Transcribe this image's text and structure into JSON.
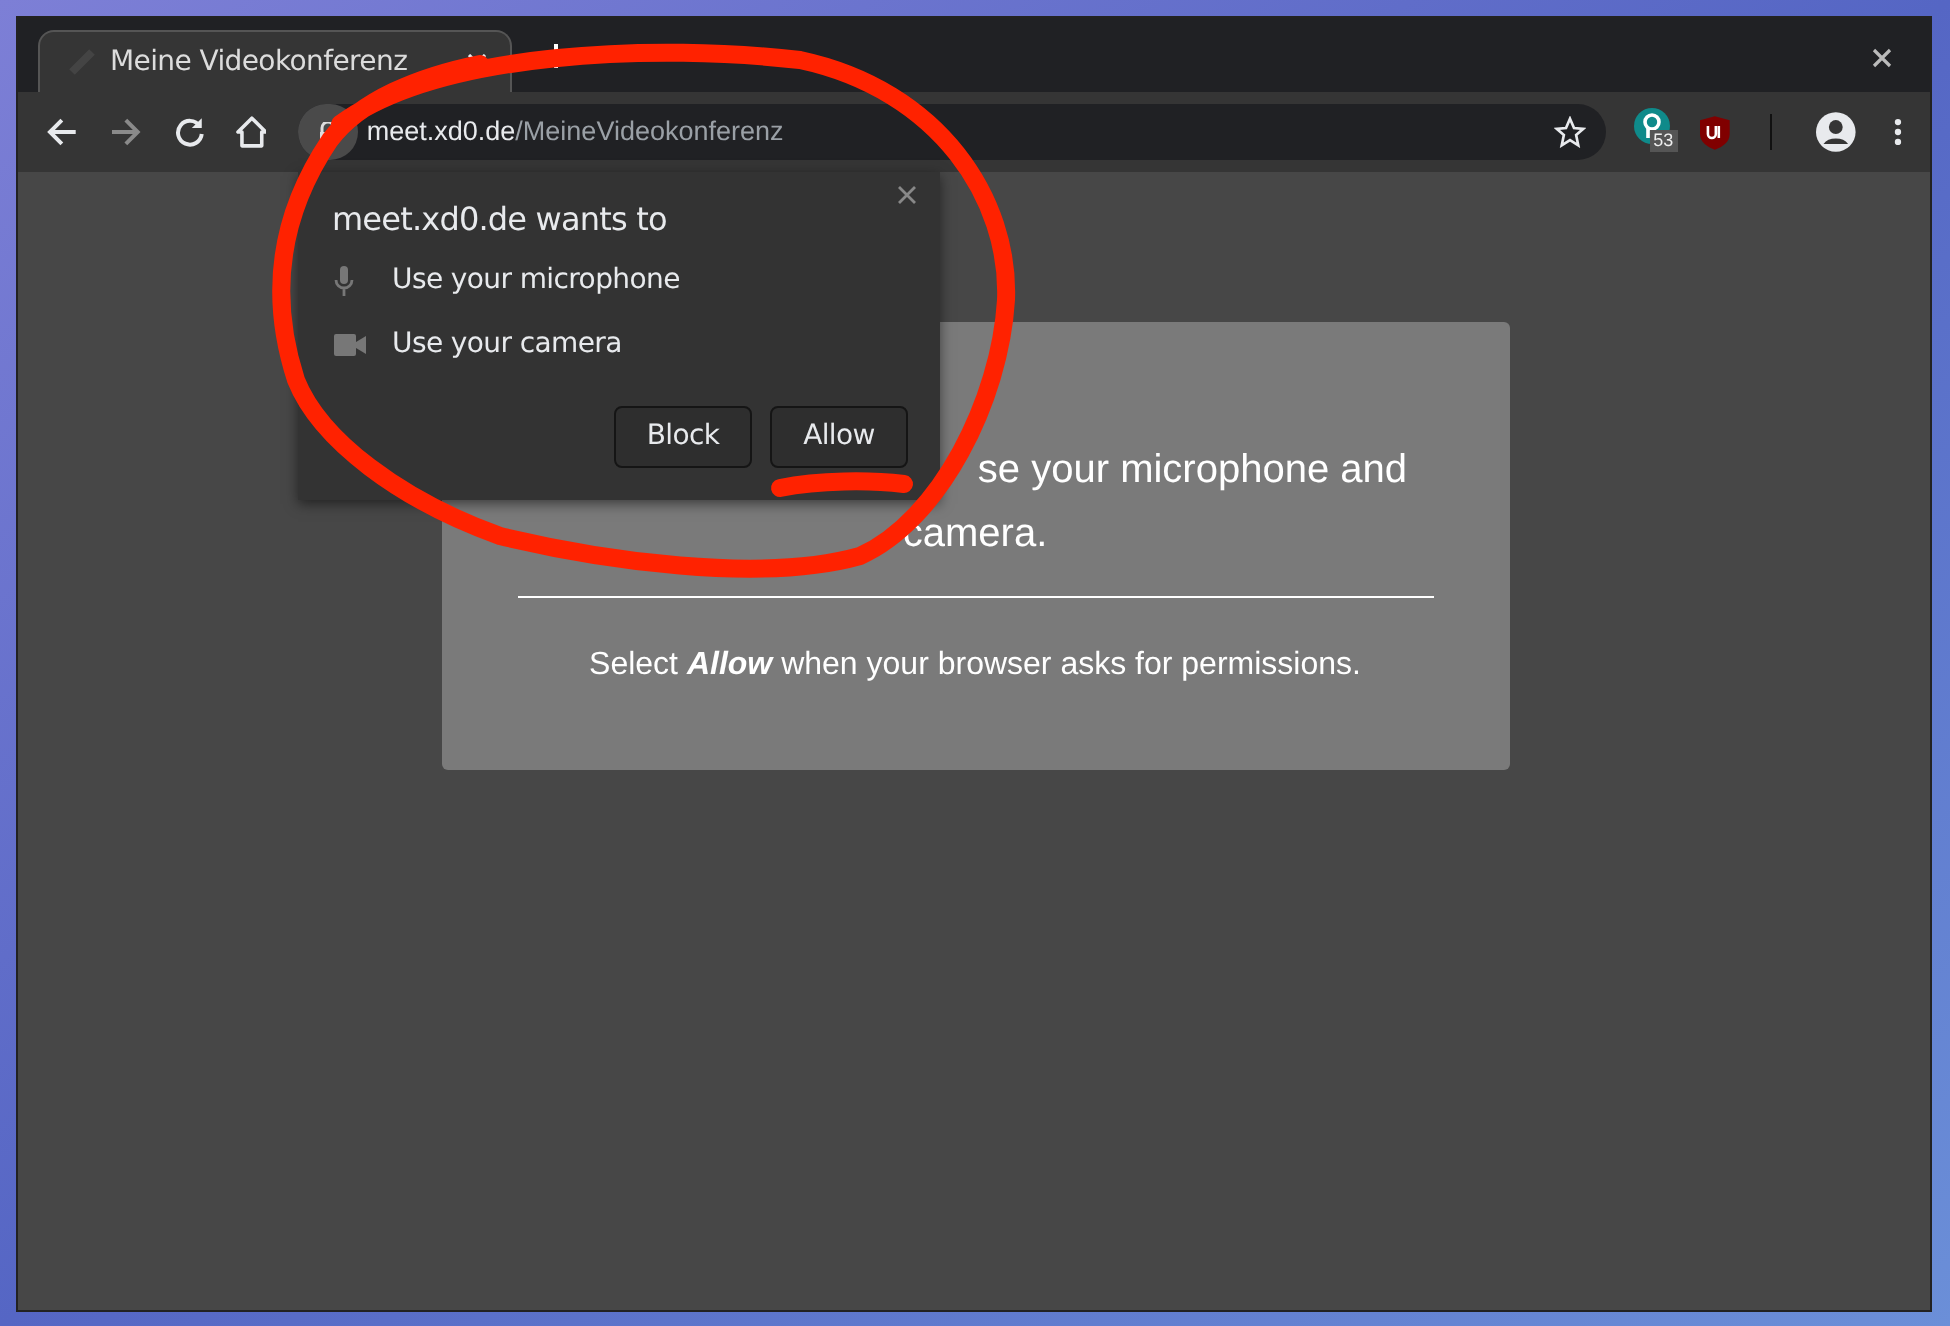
{
  "browser": {
    "tabs": [
      {
        "title": "Meine Videokonferenz",
        "selected": true
      }
    ],
    "address": {
      "host": "meet.xd0.de",
      "path": "/MeineVideokonferenz"
    },
    "extension_badge": "53"
  },
  "permission_popup": {
    "title": "meet.xd0.de wants to",
    "permissions": [
      {
        "kind": "microphone",
        "label": "Use your microphone"
      },
      {
        "kind": "camera",
        "label": "Use your camera"
      }
    ],
    "buttons": [
      "Block",
      "Allow"
    ]
  },
  "page_card": {
    "headline_lines": [
      "se your microphone and",
      "camera."
    ],
    "instruction": "Select **Allow** when your browser asks for permissions."
  }
}
